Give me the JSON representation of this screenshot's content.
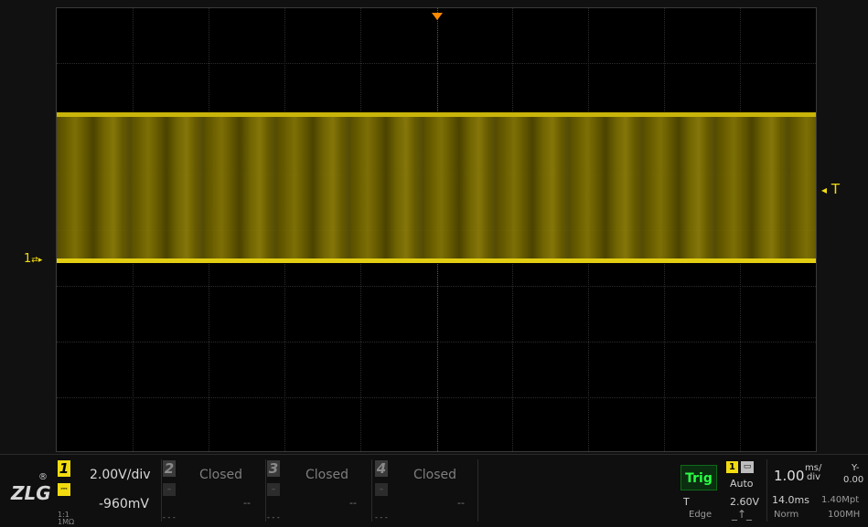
{
  "channel1": {
    "number": "1",
    "volts_per_div": "2.00V/div",
    "offset": "-960mV",
    "probe": "1:1",
    "impedance": "1MΩ",
    "marker": "1",
    "color": "#f2dc10"
  },
  "channel2": {
    "number": "2",
    "status": "Closed",
    "value": "--",
    "color": "#9a9a9a"
  },
  "channel3": {
    "number": "3",
    "status": "Closed",
    "value": "--",
    "color": "#9a9a9a"
  },
  "channel4": {
    "number": "4",
    "status": "Closed",
    "value": "--",
    "color": "#9a9a9a"
  },
  "trigger": {
    "label": "Trig",
    "source": "1",
    "mode": "Auto",
    "level_symbol": "T",
    "level": "2.60V",
    "type": "Edge",
    "marker": "T"
  },
  "timebase": {
    "value": "1.00",
    "unit_top": "ms/",
    "unit_bottom": "div",
    "position": "14.0ms",
    "memory_depth": "1.40Mpt",
    "status": "Norm",
    "bandwidth": "100MH"
  },
  "right_cut": {
    "label": "Y-",
    "value": "0.00"
  },
  "logo": {
    "text": "ZLG",
    "mark": "®"
  }
}
